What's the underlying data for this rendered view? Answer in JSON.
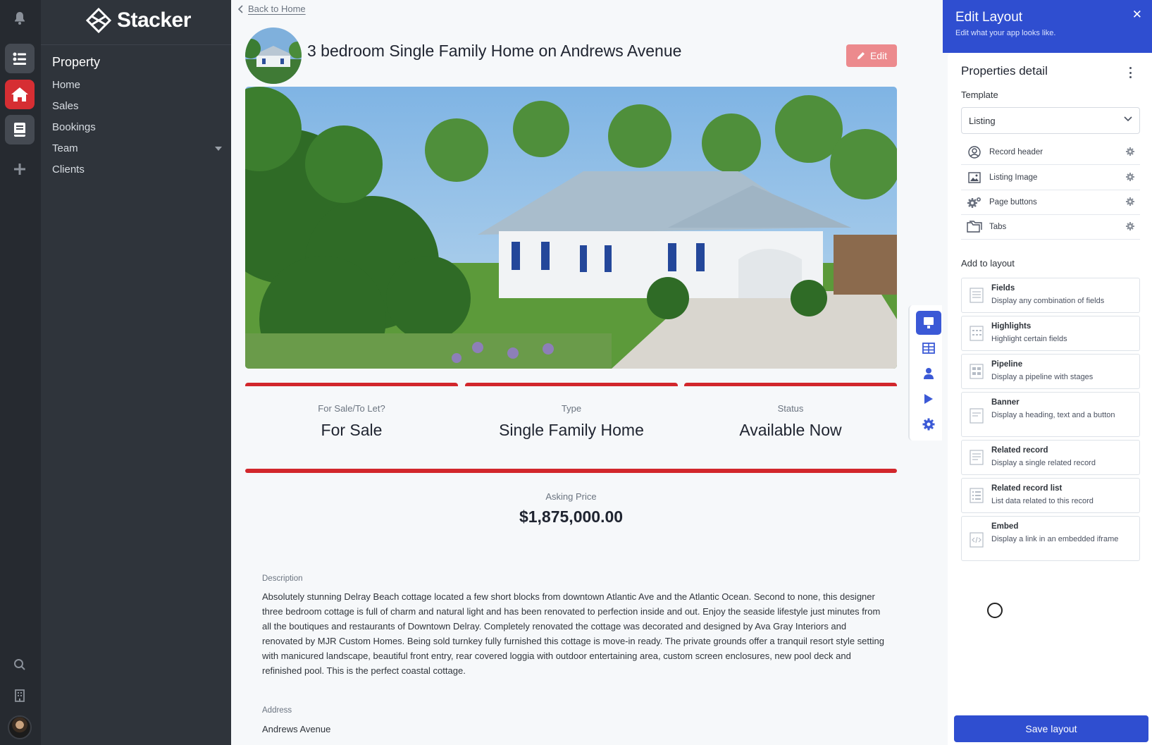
{
  "app": {
    "logo_text": "Stacker"
  },
  "sidebar": {
    "section_title": "Property",
    "items": [
      {
        "label": "Home"
      },
      {
        "label": "Sales"
      },
      {
        "label": "Bookings"
      },
      {
        "label": "Team",
        "has_dropdown": true
      },
      {
        "label": "Clients"
      }
    ]
  },
  "main": {
    "back_link": "Back to Home",
    "title": "3 bedroom Single Family Home on Andrews Avenue",
    "edit_label": "Edit",
    "stats": [
      {
        "label": "For Sale/To Let?",
        "value": "For Sale"
      },
      {
        "label": "Type",
        "value": "Single Family Home"
      },
      {
        "label": "Status",
        "value": "Available Now"
      }
    ],
    "price": {
      "label": "Asking Price",
      "value": "$1,875,000.00"
    },
    "description": {
      "label": "Description",
      "text": "Absolutely stunning Delray Beach cottage located a few short blocks from downtown Atlantic Ave and the Atlantic Ocean. Second to none, this designer three bedroom cottage is full of charm and natural light and has been renovated to perfection inside and out. Enjoy the seaside lifestyle just minutes from all the boutiques and restaurants of Downtown Delray. Completely renovated the cottage was decorated and designed by Ava Gray Interiors and renovated by MJR Custom Homes. Being sold turnkey fully furnished this cottage is move-in ready. The private grounds offer a tranquil resort style setting with manicured landscape, beautiful front entry, rear covered loggia with outdoor entertaining area, custom screen enclosures, new pool deck and refinished pool. This is the perfect coastal cottage."
    },
    "address": {
      "label": "Address",
      "value": "Andrews Avenue"
    }
  },
  "toolstrip": {
    "tools": [
      "layout-icon",
      "table-icon",
      "user-icon",
      "play-icon",
      "settings-icon"
    ],
    "active": "layout-icon"
  },
  "panel": {
    "title": "Edit Layout",
    "subtitle": "Edit what your app looks like.",
    "section_title": "Properties detail",
    "template_label": "Template",
    "template_value": "Listing",
    "template_items": [
      {
        "label": "Record header",
        "icon": "user-circle-icon"
      },
      {
        "label": "Listing Image",
        "icon": "image-icon"
      },
      {
        "label": "Page buttons",
        "icon": "gears-icon"
      },
      {
        "label": "Tabs",
        "icon": "folder-icon"
      }
    ],
    "add_label": "Add to layout",
    "add_items": [
      {
        "name": "Fields",
        "desc": "Display any combination of fields"
      },
      {
        "name": "Highlights",
        "desc": "Highlight certain fields"
      },
      {
        "name": "Pipeline",
        "desc": "Display a pipeline with stages"
      },
      {
        "name": "Banner",
        "desc": "Display a heading, text and a button"
      },
      {
        "name": "Related record",
        "desc": "Display a single related record"
      },
      {
        "name": "Related record list",
        "desc": "List data related to this record"
      },
      {
        "name": "Embed",
        "desc": "Display a link in an embedded iframe"
      }
    ],
    "save_label": "Save layout"
  },
  "colors": {
    "brand_blue": "#2f4ed0",
    "accent_red": "#d2272c",
    "edit_button": "#ec8a8d",
    "sidebar_bg": "#2f343b",
    "rail_bg": "#262a30"
  }
}
